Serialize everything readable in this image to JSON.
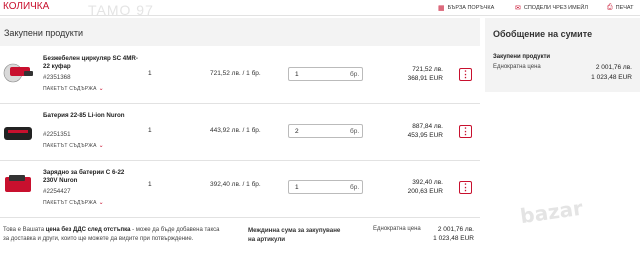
{
  "page_title": "КОЛИЧКА",
  "watermark": "TAMO 97",
  "top_links": [
    {
      "label": "БЪРЗА ПОРЪЧКА",
      "icon": "fast-order-icon"
    },
    {
      "label": "СПОДЕЛИ ЧРЕЗ ИМЕЙЛ",
      "icon": "share-email-icon"
    },
    {
      "label": "ПЕЧАТ",
      "icon": "print-icon"
    }
  ],
  "section_title": "Закупени продукти",
  "products": [
    {
      "name": "Безжебелен циркуляр SC 4MR-22 куфар",
      "number": "#2351368",
      "package_label": "ПАКЕТЪТ СЪДЪРЖА",
      "qty": "1",
      "unit_price": "721,52 лв. / 1 бр.",
      "qty_value": "1",
      "qty_unit": "бр.",
      "total_bgn": "721,52 лв.",
      "total_eur": "368,91 EUR"
    },
    {
      "name": "Батерия 22-85 Li-ion Nuron",
      "number": "#2251351",
      "package_label": "ПАКЕТЪТ СЪДЪРЖА",
      "qty": "1",
      "unit_price": "443,92 лв. / 1 бр.",
      "qty_value": "2",
      "qty_unit": "бр.",
      "total_bgn": "887,84 лв.",
      "total_eur": "453,95 EUR"
    },
    {
      "name": "Зарядно за батерии C 6-22 230V Nuron",
      "number": "#2254427",
      "package_label": "ПАКЕТЪТ СЪДЪРЖА",
      "qty": "1",
      "unit_price": "392,40 лв. / 1 бр.",
      "qty_value": "1",
      "qty_unit": "бр.",
      "total_bgn": "392,40 лв.",
      "total_eur": "200,63 EUR"
    }
  ],
  "summary": {
    "title": "Обобщение на сумите",
    "subtitle": "Закупени продукти",
    "label": "Еднократна цена",
    "value_bgn": "2 001,76 лв.",
    "value_eur": "1 023,48 EUR"
  },
  "footer": {
    "note_prefix": "Това е Вашата ",
    "note_bold": "цена без ДДС след отстъпка",
    "note_suffix": " - може да бъде добавена такса за доставка и други, които ще можете да видите при потвърждение.",
    "subtotal_label": "Междинна сума за закупуване на артикули",
    "price_label": "Еднократна цена",
    "value_bgn": "2 001,76 лв.",
    "value_eur": "1 023,48 EUR"
  },
  "bazar_mark": "bazar",
  "colors": {
    "accent": "#c8102e",
    "panel": "#f3f3f3"
  }
}
